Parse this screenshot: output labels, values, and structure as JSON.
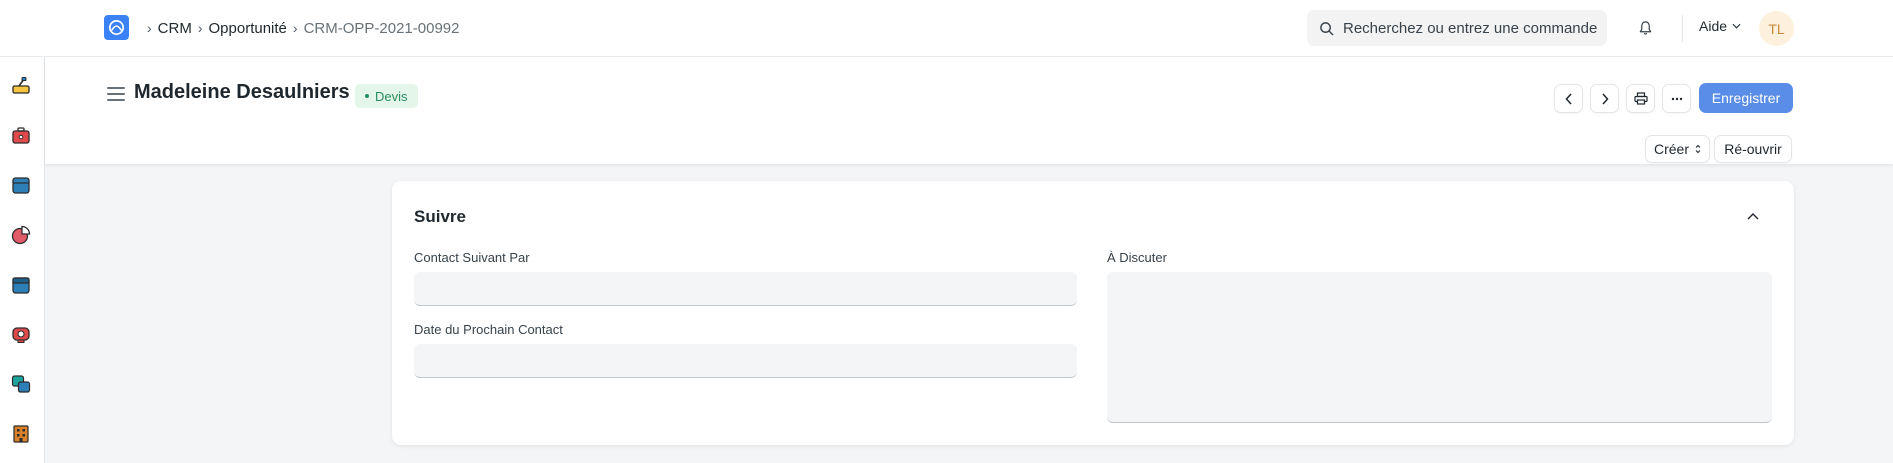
{
  "navbar": {
    "breadcrumbs": [
      "CRM",
      "Opportunité",
      "CRM-OPP-2021-00992"
    ],
    "search_placeholder": "Recherchez ou entrez une commande",
    "help_label": "Aide",
    "avatar_initials": "TL"
  },
  "sidebar": {
    "items": [
      {
        "icon": "tools-icon",
        "color": "#f5c542"
      },
      {
        "icon": "toolbox-icon",
        "color": "#e04a4a"
      },
      {
        "icon": "package-icon",
        "color": "#2d7fb8"
      },
      {
        "icon": "pie-chart-icon",
        "color": "#e05a6a"
      },
      {
        "icon": "archive-box-icon",
        "color": "#2d7fb8"
      },
      {
        "icon": "support-icon",
        "color": "#e04a4a"
      },
      {
        "icon": "stack-icon",
        "color": "#1ba39c"
      },
      {
        "icon": "building-icon",
        "color": "#d9822b"
      }
    ]
  },
  "page": {
    "title": "Madeleine Desaulniers",
    "status": "Devis",
    "save_label": "Enregistrer",
    "create_label": "Créer",
    "reopen_label": "Ré-ouvrir"
  },
  "section": {
    "title": "Suivre",
    "fields": {
      "contact_by_label": "Contact Suivant Par",
      "contact_by_value": "",
      "next_contact_date_label": "Date du Prochain Contact",
      "next_contact_date_value": "",
      "to_discuss_label": "À Discuter",
      "to_discuss_value": ""
    }
  },
  "colors": {
    "primary": "#5a8de8",
    "status_bg": "#e4f5e9",
    "status_text": "#278f5e"
  }
}
